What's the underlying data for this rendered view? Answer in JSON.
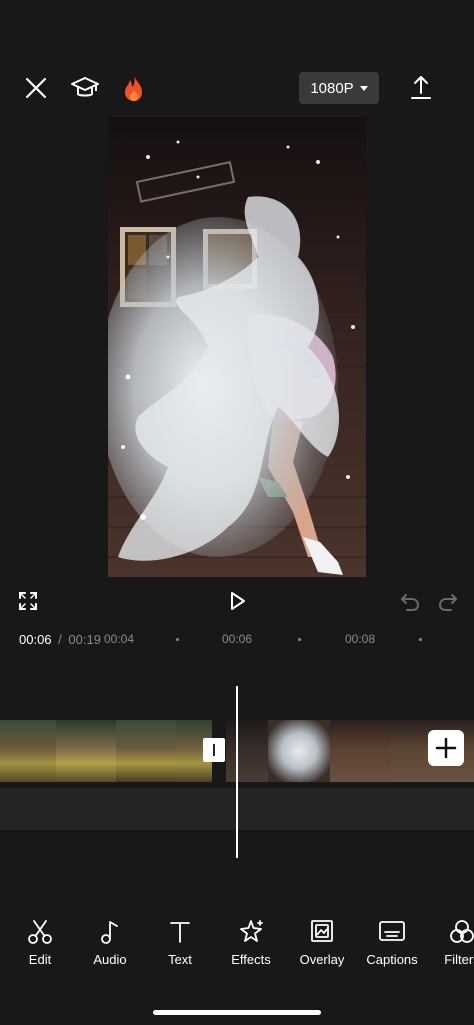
{
  "header": {
    "resolution": "1080P",
    "icons": [
      "close-icon",
      "tutorial-cap-icon",
      "fire-icon",
      "export-icon"
    ]
  },
  "player": {
    "current_time": "00:06",
    "separator": "/",
    "total_time": "00:19"
  },
  "ruler": {
    "labels": [
      "00:04",
      "00:06",
      "00:08"
    ]
  },
  "toolbar": {
    "items": [
      {
        "label": "Edit",
        "icon": "scissors-icon"
      },
      {
        "label": "Audio",
        "icon": "music-note-icon"
      },
      {
        "label": "Text",
        "icon": "text-icon"
      },
      {
        "label": "Effects",
        "icon": "sparkle-star-icon"
      },
      {
        "label": "Overlay",
        "icon": "overlay-icon"
      },
      {
        "label": "Captions",
        "icon": "captions-icon"
      },
      {
        "label": "Filters",
        "icon": "filters-icon"
      }
    ]
  },
  "colors": {
    "background": "#181818",
    "fire": "#f2502a",
    "resolution_button": "#3a3a3a"
  }
}
